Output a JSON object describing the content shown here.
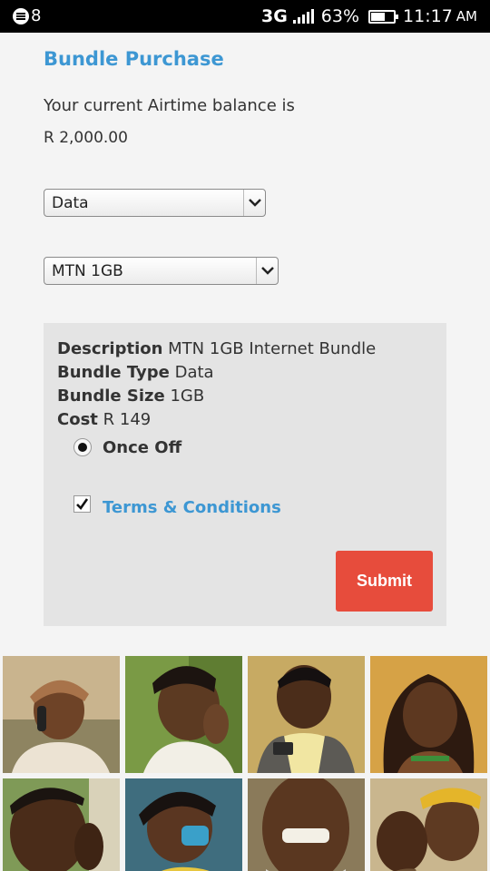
{
  "status_bar": {
    "notification_count": "8",
    "network": "3G",
    "battery_percent": "63%",
    "battery_level": 0.63,
    "time": "11:17",
    "ampm": "AM"
  },
  "form": {
    "title": "Bundle Purchase",
    "balance_label": "Your current Airtime balance is",
    "balance_value": "R 2,000.00",
    "category_select": "Data",
    "bundle_select": "MTN 1GB"
  },
  "details": {
    "description_label": "Description",
    "description_value": "MTN 1GB Internet Bundle",
    "type_label": "Bundle Type",
    "type_value": "Data",
    "size_label": "Bundle Size",
    "size_value": "1GB",
    "cost_label": "Cost",
    "cost_value": "R 149",
    "option_label": "Once Off",
    "terms_label": "Terms & Conditions",
    "submit_label": "Submit"
  },
  "colors": {
    "accent_blue": "#3d97d3",
    "submit_red": "#e74c3c",
    "panel_bg": "#e4e4e4",
    "page_bg": "#f4f4f4"
  },
  "photos": [
    "photo-elderly-woman-on-phone",
    "photo-woman-smiling",
    "photo-man-with-phone",
    "photo-woman-braids-smiling",
    "photo-man-on-phone",
    "photo-girl-on-phone",
    "photo-elderly-man-smiling",
    "photo-elderly-couple"
  ]
}
